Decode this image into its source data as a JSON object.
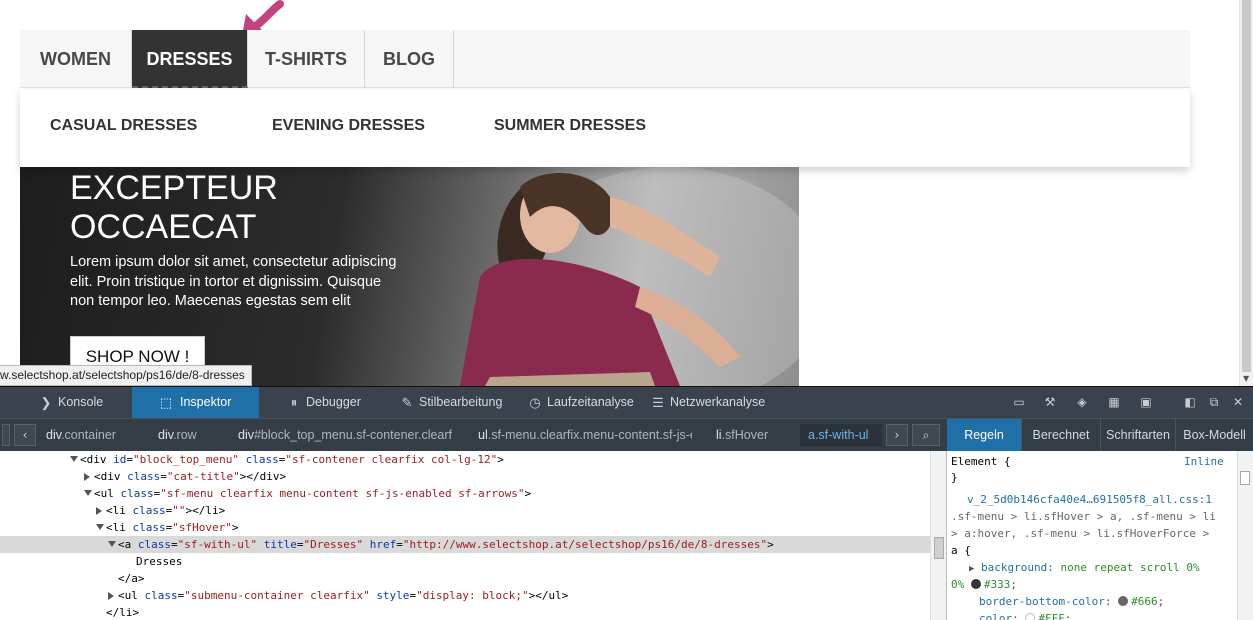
{
  "menu": {
    "items": [
      {
        "label": "WOMEN"
      },
      {
        "label": "DRESSES"
      },
      {
        "label": "T-SHIRTS"
      },
      {
        "label": "BLOG"
      }
    ],
    "active": "DRESSES"
  },
  "submenu": {
    "items": [
      {
        "label": "CASUAL DRESSES"
      },
      {
        "label": "EVENING DRESSES"
      },
      {
        "label": "SUMMER DRESSES"
      }
    ]
  },
  "banner": {
    "title_line1": "EXCEPTEUR",
    "title_line2": "OCCAECAT",
    "text_line1": "Lorem ipsum dolor sit amet, consectetur adipiscing",
    "text_line2": "elit. Proin tristique in tortor et dignissim. Quisque",
    "text_line3": "non tempor leo. Maecenas egestas sem elit",
    "button_label": "SHOP NOW !"
  },
  "status_url": "w.selectshop.at/selectshop/ps16/de/8-dresses",
  "devtools": {
    "tabs": [
      {
        "label": "Konsole",
        "icon": "console-icon"
      },
      {
        "label": "Inspektor",
        "icon": "inspector-icon"
      },
      {
        "label": "Debugger",
        "icon": "debugger-icon"
      },
      {
        "label": "Stilbearbeitung",
        "icon": "style-editor-icon"
      },
      {
        "label": "Laufzeitanalyse",
        "icon": "profiler-icon"
      },
      {
        "label": "Netzwerkanalyse",
        "icon": "network-icon"
      }
    ],
    "active_tab": "Inspektor",
    "breadcrumbs": [
      {
        "tag": "div",
        "rest": ".container"
      },
      {
        "tag": "div",
        "rest": ".row"
      },
      {
        "tag": "div",
        "rest": "#block_top_menu.sf-contener.clearfi"
      },
      {
        "tag": "ul",
        "rest": ".sf-menu.clearfix.menu-content.sf-js-e"
      },
      {
        "tag": "li",
        "rest": ".sfHover"
      },
      {
        "tag": "a",
        "rest": ".sf-with-ul"
      }
    ],
    "side_tabs": [
      {
        "label": "Regeln"
      },
      {
        "label": "Berechnet"
      },
      {
        "label": "Schriftarten"
      },
      {
        "label": "Box-Modell"
      }
    ],
    "markup": {
      "l1_id": "block_top_menu",
      "l1_class": "sf-contener clearfix col-lg-12",
      "l2_class": "cat-title",
      "l3_class": "sf-menu clearfix menu-content sf-js-enabled sf-arrows",
      "l4_class": "",
      "l5_class": "sfHover",
      "l6_class": "sf-with-ul",
      "l6_title": "Dresses",
      "l6_href": "http://www.selectshop.at/selectshop/ps16/de/8-dresses",
      "l7_text": "Dresses",
      "l9_class": "submenu-container clearfix",
      "l9_style": "display: block;"
    },
    "rules": {
      "element_label": "Element {",
      "inline_label": "Inline",
      "close_brace": "}",
      "source": "v_2_5d0b146cfa40e4…691505f8_all.css:1",
      "selector_line1": ".sf-menu > li.sfHover > a, .sf-menu > li",
      "selector_line2": "> a:hover, .sf-menu > li.sfHoverForce >",
      "selector_line3": "a {",
      "prop1_name": "background",
      "prop1_value": "none repeat scroll 0%",
      "prop1_value2": "0%",
      "prop1_color": "#333",
      "prop2_name": "border-bottom-color",
      "prop2_color": "#666",
      "prop3_name": "color",
      "prop3_color": "#FFF"
    }
  }
}
